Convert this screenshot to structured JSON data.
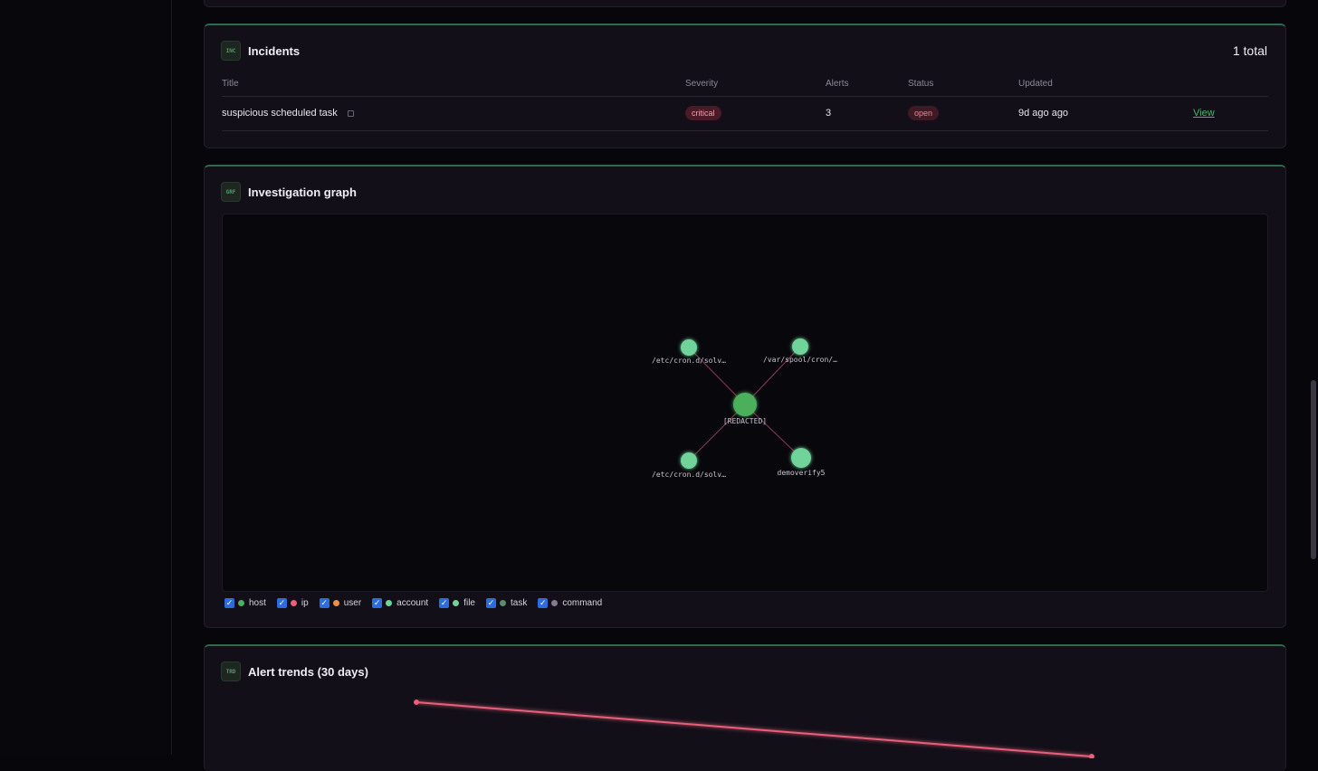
{
  "incidents": {
    "badge": "INC",
    "title": "Incidents",
    "total": "1 total",
    "columns": [
      "Title",
      "Severity",
      "Alerts",
      "Status",
      "Updated"
    ],
    "rows": [
      {
        "title": "suspicious scheduled task",
        "severity": "critical",
        "alerts": "3",
        "status": "open",
        "updated": "9d ago ago",
        "action": "View"
      }
    ]
  },
  "graph": {
    "badge": "GRF",
    "title": "Investigation graph",
    "nodes": [
      {
        "id": "center",
        "label": "[REDACTED]",
        "type": "host"
      },
      {
        "id": "n1",
        "label": "/etc/cron.d/solv…",
        "type": "file"
      },
      {
        "id": "n2",
        "label": "/var/spool/cron/…",
        "type": "file"
      },
      {
        "id": "n3",
        "label": "/etc/cron.d/solv…",
        "type": "file"
      },
      {
        "id": "n4",
        "label": "demoverify5",
        "type": "account"
      }
    ],
    "legend": [
      {
        "label": "host",
        "color": "#4caf5c",
        "checked": true
      },
      {
        "label": "ip",
        "color": "#e8607a",
        "checked": true
      },
      {
        "label": "user",
        "color": "#e8904a",
        "checked": true
      },
      {
        "label": "account",
        "color": "#6fd39a",
        "checked": true
      },
      {
        "label": "file",
        "color": "#6fd39a",
        "checked": true
      },
      {
        "label": "task",
        "color": "#5e8a6e",
        "checked": true
      },
      {
        "label": "command",
        "color": "#857a92",
        "checked": true
      }
    ],
    "colors": {
      "host": "#4caf5c",
      "file": "#6fd39a",
      "account": "#6fd39a",
      "edge": "#8a3a55"
    }
  },
  "trends": {
    "badge": "TRD",
    "title": "Alert trends (30 days)",
    "line_color": "#e8607a"
  }
}
